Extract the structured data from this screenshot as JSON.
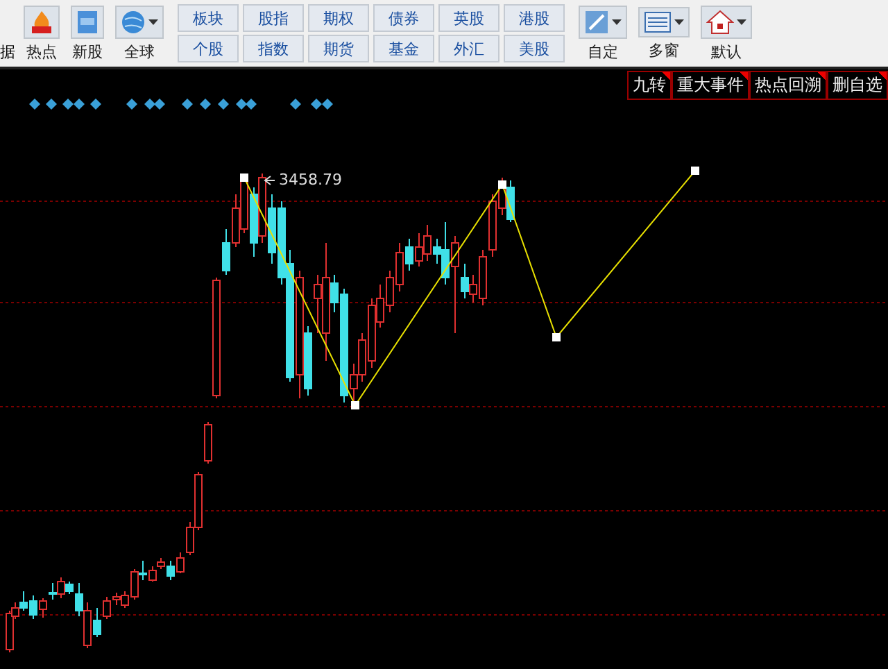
{
  "toolbar": {
    "cut_label": "据",
    "tools": [
      {
        "label": "热点",
        "dropdown": false
      },
      {
        "label": "新股",
        "dropdown": false
      },
      {
        "label": "全球",
        "dropdown": true
      }
    ],
    "markets": [
      [
        "板块",
        "个股"
      ],
      [
        "股指",
        "指数"
      ],
      [
        "期权",
        "期货"
      ],
      [
        "债券",
        "基金"
      ],
      [
        "英股",
        "外汇"
      ],
      [
        "港股",
        "美股"
      ]
    ],
    "views": [
      {
        "label": "自定",
        "dropdown": true
      },
      {
        "label": "多窗",
        "dropdown": true
      },
      {
        "label": "默认",
        "dropdown": true
      }
    ]
  },
  "chart": {
    "tags": [
      "九转",
      "重大事件",
      "热点回溯",
      "删自选"
    ],
    "peak_label": "3458.79"
  }
}
